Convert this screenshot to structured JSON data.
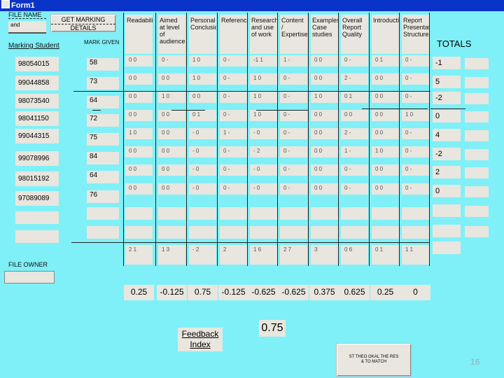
{
  "window": {
    "title": "Form1"
  },
  "file_name": {
    "label": "FILE NAME",
    "value": "and"
  },
  "get_marking_button": {
    "line1": "GET MARKING",
    "line2": "DETAILS"
  },
  "marking_student_label": "Marking Student",
  "mark_given_label": "MARK GIVEN",
  "totals_label": "TOTALS",
  "columns": [
    "Readability",
    "Aimed at level of audience",
    "Personal Conclusion",
    "References",
    "Research and use of work",
    "Content / Expertise",
    "Examples Case studies",
    "Overall Report Quality",
    "Introduction",
    "Report Presentation Structure"
  ],
  "students": [
    {
      "id": "98054015",
      "mark": "58",
      "total": "-1"
    },
    {
      "id": "99044858",
      "mark": "73",
      "total": "5"
    },
    {
      "id": "98073540",
      "mark": "64",
      "total": "-2"
    },
    {
      "id": "98041150",
      "mark": "72",
      "total": "0"
    },
    {
      "id": "99044315",
      "mark": "75",
      "total": "4"
    },
    {
      "id": "99078996",
      "mark": "84",
      "total": "-2"
    },
    {
      "id": "98015192",
      "mark": "64",
      "total": "2"
    },
    {
      "id": "97089089",
      "mark": "76",
      "total": "0"
    }
  ],
  "grid_rows": [
    [
      "0 0",
      "0 -",
      "1 0",
      "0 -",
      "-1 1",
      "1 -",
      "0 0",
      "0 -",
      "0 1",
      "0 -"
    ],
    [
      "0 0",
      "0 0",
      "1 0",
      "0 -",
      "1 0",
      "0 -",
      "0 0",
      "2 -",
      "0 0",
      "0 -"
    ],
    [
      "0 0",
      "1 0",
      "0 0",
      "0 -",
      "1 0",
      "0 -",
      "1 0",
      "0 1",
      "0 0",
      "0 -"
    ],
    [
      "0 0",
      "0 0",
      "0 1",
      "0 -",
      "1 0",
      "0 -",
      "0 0",
      "0 0",
      "0 0",
      "1 0"
    ],
    [
      "1 0",
      "0 0",
      "- 0",
      "1 -",
      "- 0",
      "0 -",
      "0 0",
      "2 -",
      "0 0",
      "0 -"
    ],
    [
      "0 0",
      "0 0",
      "- 0",
      "0 -",
      "- 2",
      "0 -",
      "0 0",
      "1 -",
      "1 0",
      "0 -"
    ],
    [
      "0 0",
      "0 0",
      "- 0",
      "0 -",
      "- 0",
      "0 -",
      "0 0",
      "0 -",
      "0 0",
      "0 -"
    ],
    [
      "0 0",
      "0 0",
      "- 0",
      "0 -",
      "- 0",
      "0 -",
      "0 0",
      "0 -",
      "0 0",
      "0 -"
    ]
  ],
  "sum_row": [
    "2 1",
    "1 3",
    "- 2",
    "2",
    "1 6",
    "2 7",
    "3",
    "0 6",
    "0 1",
    "1 1"
  ],
  "results": [
    "0.25",
    "-0.125",
    "0.75",
    "-0.125",
    "-0.625",
    "-0.625",
    "0.375",
    "0.625",
    "0.25",
    "0"
  ],
  "file_owner_label": "FILE OWNER",
  "feedback": {
    "line1": "Feedback",
    "line2": "Index",
    "value": "0.75"
  },
  "bottom_button": {
    "line1": "ST THEO OKAL THE RES",
    "line2": "& TO MATCH"
  },
  "page_number": "16"
}
